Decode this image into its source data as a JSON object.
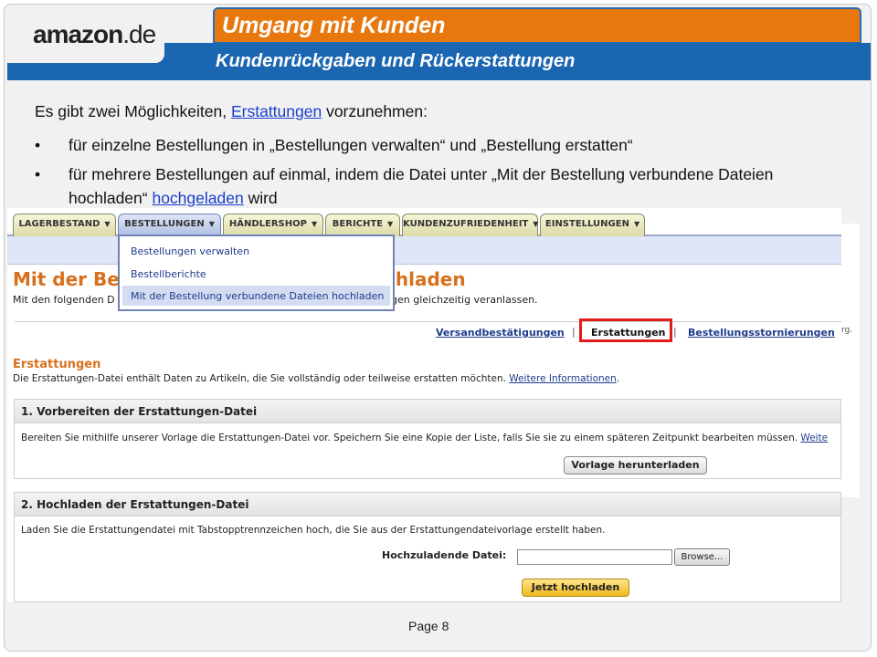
{
  "brand": {
    "logo_main": "amazon",
    "logo_tld": ".de"
  },
  "slide": {
    "title": "Umgang mit Kunden",
    "subtitle": "Kundenrückgaben und Rückerstattungen",
    "intro_before": "Es gibt zwei Möglichkeiten, ",
    "intro_link": "Erstattungen",
    "intro_after": " vorzunehmen:",
    "bullets": [
      {
        "text": "für einzelne Bestellungen in „Bestellungen verwalten“ und „Bestellung erstatten“"
      },
      {
        "text_before": "für mehrere Bestellungen auf einmal, indem die Datei unter „Mit der Bestellung verbundene Dateien hochladen“ ",
        "link": "hochgeladen",
        "text_after": " wird"
      }
    ],
    "bullet_char": "•",
    "page_number": "Page 8"
  },
  "screenshot": {
    "tabs": [
      "LAGERBESTAND",
      "BESTELLUNGEN",
      "HÄNDLERSHOP",
      "BERICHTE",
      "KUNDENZUFRIEDENHEIT",
      "EINSTELLUNGEN"
    ],
    "caret": "▼",
    "dropdown_items": [
      "Bestellungen verwalten",
      "Bestellberichte",
      "Mit der Bestellung verbundene Dateien hochladen"
    ],
    "heading_left": "Mit der Best",
    "heading_right": "chladen",
    "subheading_left": "Mit den folgenden D",
    "subheading_right": "gen gleichzeitig veranlassen.",
    "subnav": {
      "shipping": "Versandbestätigungen",
      "refunds": "Erstattungen",
      "cancellations": "Bestellungsstornierungen",
      "sep": "|"
    },
    "refunds_title": "Erstattungen",
    "refunds_desc": "Die Erstattungen-Datei enthält Daten zu Artikeln, die Sie vollständig oder teilweise erstatten möchten. ",
    "more_info": "Weitere Informationen",
    "refunds_desc_end": ".",
    "step1": {
      "title": "1. Vorbereiten der Erstattungen-Datei",
      "text": "Bereiten Sie mithilfe unserer Vorlage die Erstattungen-Datei vor. Speichern Sie eine Kopie der Liste, falls Sie sie zu einem späteren Zeitpunkt bearbeiten müssen. ",
      "link": "Weite",
      "button": "Vorlage herunterladen"
    },
    "step2": {
      "title": "2. Hochladen der Erstattungen-Datei",
      "text": "Laden Sie die Erstattungendatei mit Tabstopptrennzeichen hoch, die Sie aus der Erstattungendateivorlage erstellt haben.",
      "file_label": "Hochzuladende Datei:",
      "file_value": "",
      "browse": "Browse...",
      "upload_button": "Jetzt hochladen"
    },
    "side_fragment": "rg."
  },
  "colors": {
    "orange": "#e8770e",
    "blue": "#1b66b1",
    "link": "#1a3fcc",
    "highlight": "#e41b1b"
  }
}
